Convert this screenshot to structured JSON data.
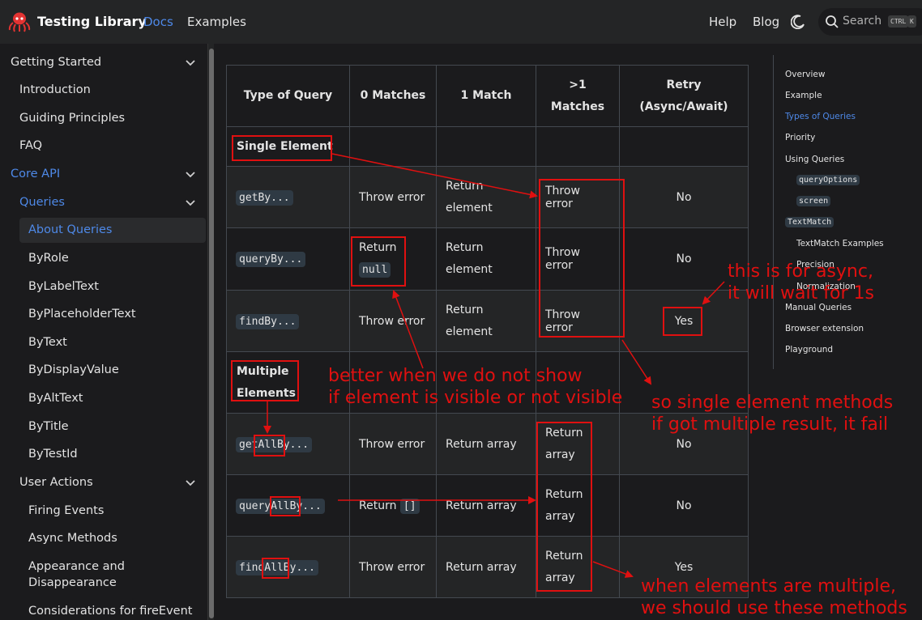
{
  "navbar": {
    "brand": "Testing Library",
    "links": [
      "Docs",
      "Examples"
    ],
    "right_links": [
      "Help",
      "Blog"
    ],
    "search_placeholder": "Search",
    "kbd": [
      "CTRL",
      "K"
    ]
  },
  "sidebar": {
    "getting_started": "Getting Started",
    "gs_items": [
      "Introduction",
      "Guiding Principles",
      "FAQ"
    ],
    "core_api": "Core API",
    "queries": "Queries",
    "query_items": [
      "About Queries",
      "ByRole",
      "ByLabelText",
      "ByPlaceholderText",
      "ByText",
      "ByDisplayValue",
      "ByAltText",
      "ByTitle",
      "ByTestId"
    ],
    "user_actions": "User Actions",
    "ua_items": [
      "Firing Events",
      "Async Methods",
      "Appearance and",
      "Disappearance",
      "Considerations for fireEvent"
    ]
  },
  "table": {
    "headers": [
      "Type of Query",
      "0 Matches",
      "1 Match",
      ">1 Matches",
      "Retry",
      "(Async/Await)"
    ],
    "single_label": "Single Element",
    "multiple_label": [
      "Multiple",
      "Elements"
    ],
    "rows": [
      {
        "query": "getBy...",
        "zero": "Throw error",
        "one": [
          "Return",
          "element"
        ],
        "many": "Throw error",
        "retry": "No"
      },
      {
        "query": "queryBy...",
        "zero_a": "Return",
        "zero_b": "null",
        "one": [
          "Return",
          "element"
        ],
        "many": "Throw error",
        "retry": "No"
      },
      {
        "query": "findBy...",
        "zero": "Throw error",
        "one": [
          "Return",
          "element"
        ],
        "many": "Throw error",
        "retry": "Yes"
      },
      {
        "query": "getAllBy...",
        "zero": "Throw error",
        "one": "Return array",
        "many": [
          "Return",
          "array"
        ],
        "retry": "No"
      },
      {
        "query": "queryAllBy...",
        "zero_a": "Return",
        "zero_b": "[]",
        "one": "Return array",
        "many": [
          "Return",
          "array"
        ],
        "retry": "No"
      },
      {
        "query": "findAllBy...",
        "zero": "Throw error",
        "one": "Return array",
        "many": [
          "Return",
          "array"
        ],
        "retry": "Yes"
      }
    ]
  },
  "toc": {
    "items": [
      "Overview",
      "Example",
      "Types of Queries",
      "Priority",
      "Using Queries",
      "queryOptions",
      "screen",
      "TextMatch",
      "TextMatch Examples",
      "Precision",
      "Normalization",
      "Manual Queries",
      "Browser extension",
      "Playground"
    ]
  },
  "annotations": {
    "async_note": [
      "this is for async,",
      "it will wait for 1s"
    ],
    "null_note": [
      "better when we do not show",
      "if element is visible or not visible"
    ],
    "single_note": [
      "so single element methods",
      "if got multiple result, it fail"
    ],
    "multi_note": [
      "when elements are multiple,",
      "we should use these methods"
    ]
  },
  "colors": {
    "accent": "#4e89e8",
    "annotation": "#e01010",
    "background": "#1b1b1d",
    "navbar": "#242526"
  }
}
